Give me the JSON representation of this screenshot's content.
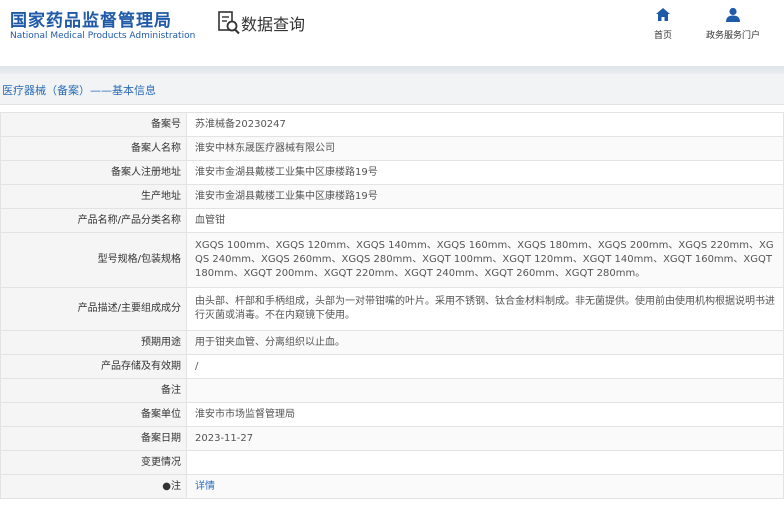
{
  "header": {
    "logo_cn": "国家药品监督管理局",
    "logo_en": "National Medical Products Administration",
    "page_title": "数据查询",
    "nav": [
      {
        "label": "首页",
        "icon": "home-icon"
      },
      {
        "label": "政务服务门户",
        "icon": "user-icon"
      }
    ]
  },
  "breadcrumb": "医疗器械（备案）——基本信息",
  "colors": {
    "brand": "#1f5aa8",
    "link": "#2c6db8",
    "label_bg": "#f5f5f5"
  },
  "rows": [
    {
      "label": "备案号",
      "value": "苏淮械备20230247"
    },
    {
      "label": "备案人名称",
      "value": "淮安中林东晟医疗器械有限公司"
    },
    {
      "label": "备案人注册地址",
      "value": "淮安市金湖县戴楼工业集中区康楼路19号"
    },
    {
      "label": "生产地址",
      "value": "淮安市金湖县戴楼工业集中区康楼路19号"
    },
    {
      "label": "产品名称/产品分类名称",
      "value": "血管钳"
    },
    {
      "label": "型号规格/包装规格",
      "value": "XGQS 100mm、XGQS 120mm、XGQS 140mm、XGQS 160mm、XGQS 180mm、XGQS 200mm、XGQS 220mm、XGQS 240mm、XGQS 260mm、XGQS 280mm、XGQT 100mm、XGQT 120mm、XGQT 140mm、XGQT 160mm、XGQT 180mm、XGQT 200mm、XGQT 220mm、XGQT 240mm、XGQT 260mm、XGQT 280mm。"
    },
    {
      "label": "产品描述/主要组成成分",
      "value": "由头部、杆部和手柄组成，头部为一对带钳嘴的叶片。采用不锈钢、钛合金材料制成。非无菌提供。使用前由使用机构根据说明书进行灭菌或消毒。不在内窥镜下使用。"
    },
    {
      "label": "预期用途",
      "value": "用于钳夹血管、分离组织以止血。"
    },
    {
      "label": "产品存储及有效期",
      "value": "/"
    },
    {
      "label": "备注",
      "value": ""
    },
    {
      "label": "备案单位",
      "value": "淮安市市场监督管理局"
    },
    {
      "label": "备案日期",
      "value": "2023-11-27"
    },
    {
      "label": "变更情况",
      "value": ""
    },
    {
      "label": "●注",
      "value": "详情"
    }
  ]
}
